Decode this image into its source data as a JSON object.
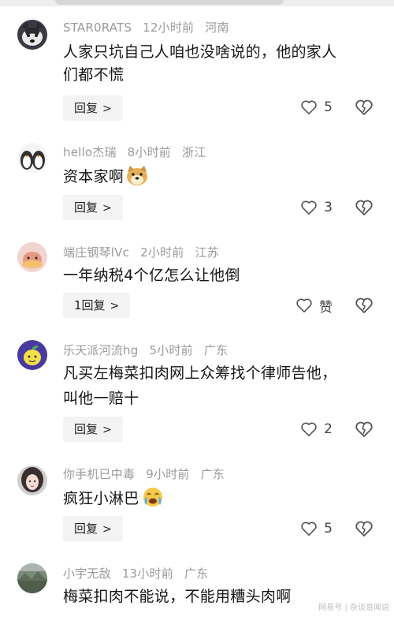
{
  "comments": [
    {
      "username": "STAR0RATS",
      "time": "12小时前",
      "location": "河南",
      "text_lines": [
        "人家只坑自己人咱也没啥说的，他的家人",
        "们都不慌"
      ],
      "reply_label": "回复",
      "like_count": "5",
      "avatar_icon": "husky-dog-avatar"
    },
    {
      "username": "hello杰瑞",
      "time": "8小时前",
      "location": "浙江",
      "text_lines": [
        "资本家啊"
      ],
      "emoji_icon": "doge-emoji",
      "reply_label": "回复",
      "like_count": "3",
      "avatar_icon": "penguin-avatar"
    },
    {
      "username": "端庄钢琴lVc",
      "time": "2小时前",
      "location": "江苏",
      "text_lines": [
        "一年纳税4个亿怎么让他倒"
      ],
      "reply_label": "1回复",
      "like_count": "赞",
      "avatar_icon": "pink-blob-avatar"
    },
    {
      "username": "乐天派河流hg",
      "time": "5小时前",
      "location": "广东",
      "text_lines": [
        "凡买左梅菜扣肉网上众筹找个律师告他，",
        "叫他一赔十"
      ],
      "reply_label": "回复",
      "like_count": "2",
      "avatar_icon": "lemon-avatar"
    },
    {
      "username": "你手机已中毒",
      "time": "9小时前",
      "location": "广东",
      "text_lines": [
        "疯狂小淋巴"
      ],
      "emoji_icon": "crying-laughing-emoji",
      "reply_label": "回复",
      "like_count": "5",
      "avatar_icon": "girl-portrait-avatar"
    },
    {
      "username": "小宇无敌",
      "time": "13小时前",
      "location": "广东",
      "text_lines": [
        "梅菜扣肉不能说，不能用糟头肉啊"
      ],
      "avatar_icon": "landscape-avatar"
    }
  ],
  "watermark": "网易号 | 杂谈哥闻说",
  "colors": {
    "meta": "#9a9a9a",
    "reply_bg": "#f3f3f3",
    "text": "#161616"
  }
}
